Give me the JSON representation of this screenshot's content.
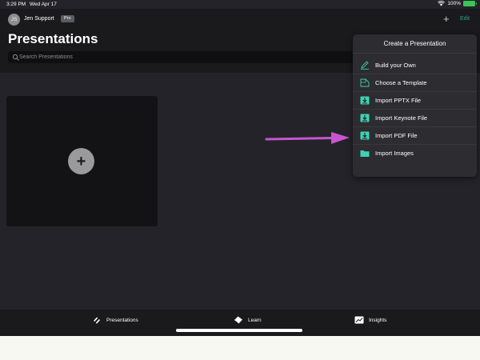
{
  "status_bar": {
    "time": "3:29 PM",
    "date": "Wed Apr 17",
    "battery": "100%",
    "battery_color": "#3cc35a"
  },
  "header": {
    "avatar_initials": "JS",
    "user_name": "Jen Support",
    "plan_badge": "Pro",
    "add_label": "+",
    "edit_label": "Edit",
    "accent_color": "#2aa882"
  },
  "page": {
    "title": "Presentations"
  },
  "search": {
    "placeholder": "Search Presentations",
    "value": ""
  },
  "new_card": {
    "icon": "+"
  },
  "popover": {
    "title": "Create a Presentation",
    "items": [
      {
        "label": "Build your Own",
        "icon": "pencil-icon"
      },
      {
        "label": "Choose a Template",
        "icon": "template-icon"
      },
      {
        "label": "Import PPTX File",
        "icon": "import-icon"
      },
      {
        "label": "Import Keynote File",
        "icon": "import-icon"
      },
      {
        "label": "Import PDF File",
        "icon": "import-icon"
      },
      {
        "label": "Import Images",
        "icon": "folder-icon"
      }
    ]
  },
  "annotation": {
    "arrow_color": "#c855d0"
  },
  "tab_bar": {
    "tabs": [
      {
        "label": "Presentations",
        "icon": "presentations-icon"
      },
      {
        "label": "Learn",
        "icon": "learn-icon"
      },
      {
        "label": "Insights",
        "icon": "insights-icon"
      }
    ]
  }
}
